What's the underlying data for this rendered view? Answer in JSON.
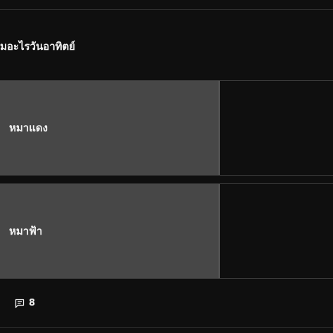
{
  "poll": {
    "question": "มอะไรวันอาทิตย์",
    "options": [
      {
        "label": "หมาแดง",
        "fill_fraction": 0.66
      },
      {
        "label": "หมาฟ้า",
        "fill_fraction": 0.66
      }
    ]
  },
  "footer": {
    "comment_icon": "comment-icon",
    "comment_count": "8"
  },
  "colors": {
    "background": "#0f0f0f",
    "option_fill": "#474747",
    "text": "#f1f1f1"
  }
}
